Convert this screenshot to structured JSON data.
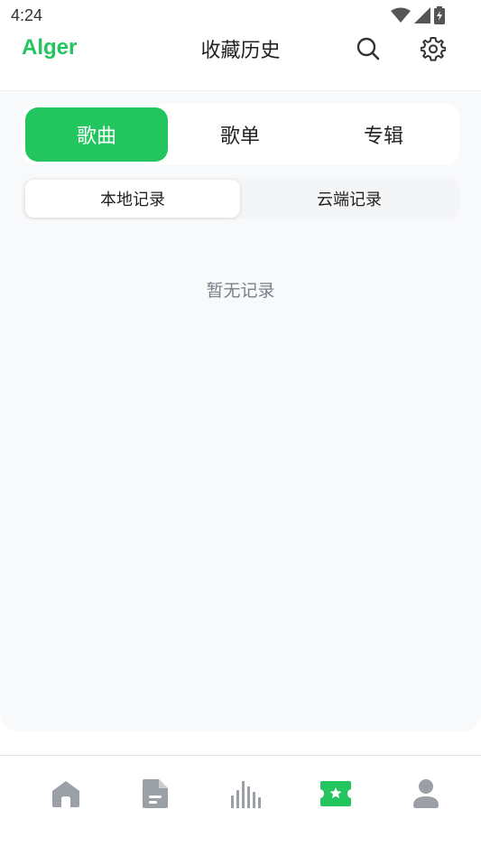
{
  "status_bar": {
    "time": "4:24",
    "icons": [
      "wifi-icon",
      "signal-icon",
      "battery-charging-icon"
    ]
  },
  "header": {
    "brand": "Alger",
    "title": "收藏历史",
    "actions": [
      "search-icon",
      "gear-icon"
    ],
    "accent_color": "#22c55e"
  },
  "type_tabs": [
    {
      "label": "歌曲",
      "active": true
    },
    {
      "label": "歌单",
      "active": false
    },
    {
      "label": "专辑",
      "active": false
    }
  ],
  "source_tabs": [
    {
      "label": "本地记录",
      "active": true
    },
    {
      "label": "云端记录",
      "active": false
    }
  ],
  "empty_state": {
    "message": "暂无记录"
  },
  "bottom_nav": [
    {
      "icon": "home-icon",
      "active": false
    },
    {
      "icon": "document-icon",
      "active": false
    },
    {
      "icon": "chart-bars-icon",
      "active": false
    },
    {
      "icon": "ticket-star-icon",
      "active": true
    },
    {
      "icon": "user-icon",
      "active": false
    }
  ]
}
